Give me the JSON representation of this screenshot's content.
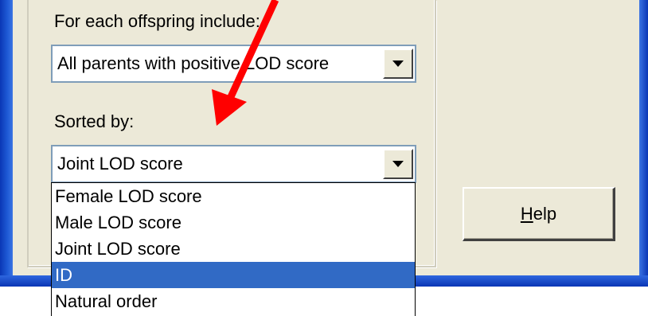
{
  "dialog": {
    "include_label": "For each offspring include:",
    "include_value": "All parents with positive LOD score",
    "sorted_label": "Sorted by:",
    "sorted_value": "Joint LOD score",
    "sort_options": [
      "Female LOD score",
      "Male LOD score",
      "Joint LOD score",
      "ID",
      "Natural order"
    ],
    "selected_option": "ID",
    "help_label_first": "H",
    "help_label_rest": "elp"
  },
  "annotation": {
    "arrow_color": "#ff0000",
    "arrow_icon": "red-arrow"
  },
  "colors": {
    "selection": "#316ac5",
    "dialog_bg": "#ece9d8",
    "frame_blue": "#0a36b5"
  }
}
